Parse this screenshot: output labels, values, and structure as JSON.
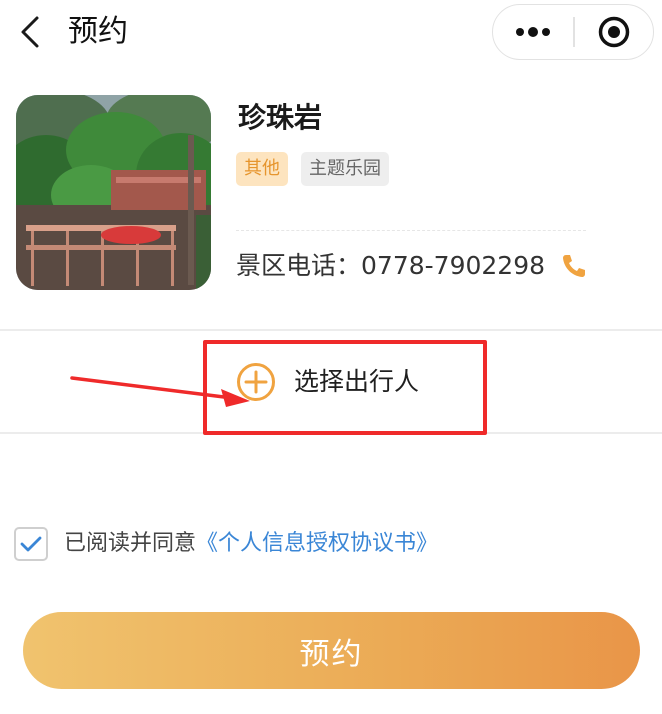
{
  "header": {
    "title": "预约",
    "back_icon": "chevron-left-icon",
    "more_icon": "more-dots-icon",
    "close_icon": "target-circle-icon"
  },
  "scenic": {
    "name": "珍珠岩",
    "tags": [
      "其他",
      "主题乐园"
    ],
    "phone_label": "景区电话：",
    "phone_number": "0778-7902298",
    "phone_icon": "phone-icon"
  },
  "traveler": {
    "label": "选择出行人",
    "icon": "plus-circle-icon"
  },
  "agreement": {
    "checked": true,
    "prefix": "已阅读并同意",
    "link": "《个人信息授权协议书》"
  },
  "submit": {
    "label": "预约"
  },
  "colors": {
    "accent": "#F0A84E",
    "link": "#3A86D6",
    "annotation": "#EF2A2A",
    "tag_other_bg": "#FDE4BF",
    "tag_other_text": "#E6952D"
  }
}
